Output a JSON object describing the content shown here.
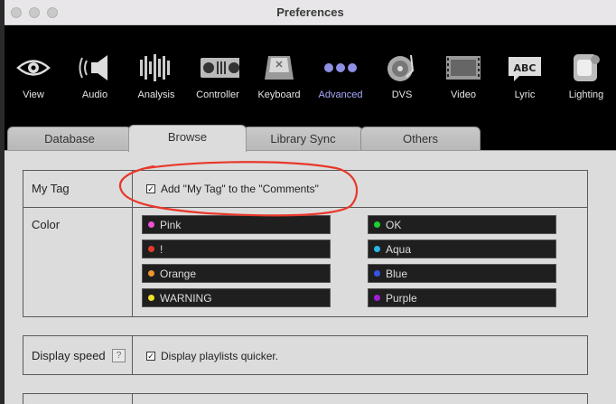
{
  "window": {
    "title": "Preferences"
  },
  "toolbar": {
    "items": [
      {
        "label": "View",
        "icon": "eye-icon"
      },
      {
        "label": "Audio",
        "icon": "speaker-icon"
      },
      {
        "label": "Analysis",
        "icon": "waveform-icon"
      },
      {
        "label": "Controller",
        "icon": "controller-icon"
      },
      {
        "label": "Keyboard",
        "icon": "keyboard-icon"
      },
      {
        "label": "Advanced",
        "icon": "dots-icon",
        "active": true
      },
      {
        "label": "DVS",
        "icon": "turntable-icon"
      },
      {
        "label": "Video",
        "icon": "film-icon"
      },
      {
        "label": "Lyric",
        "icon": "abc-icon"
      },
      {
        "label": "Lighting",
        "icon": "moving-head-icon"
      }
    ]
  },
  "tabs": [
    {
      "label": "Database"
    },
    {
      "label": "Browse",
      "active": true
    },
    {
      "label": "Library Sync"
    },
    {
      "label": "Others"
    }
  ],
  "my_tag": {
    "label": "My Tag",
    "option_label": "Add \"My Tag\" to the \"Comments\"",
    "checked": true
  },
  "color": {
    "label": "Color",
    "items": [
      {
        "name": "Pink",
        "color": "#ee4fd6"
      },
      {
        "name": "OK",
        "color": "#1fcf2f"
      },
      {
        "name": "!",
        "color": "#e43b2b"
      },
      {
        "name": "Aqua",
        "color": "#2ab7e8"
      },
      {
        "name": "Orange",
        "color": "#f0962d"
      },
      {
        "name": "Blue",
        "color": "#3554e6"
      },
      {
        "name": "WARNING",
        "color": "#f0e02a"
      },
      {
        "name": "Purple",
        "color": "#a31ed6"
      }
    ]
  },
  "display_speed": {
    "label": "Display speed",
    "help_label": "?",
    "option_label": "Display playlists quicker.",
    "checked": true
  },
  "annotation": {
    "color": "#e8382a"
  }
}
